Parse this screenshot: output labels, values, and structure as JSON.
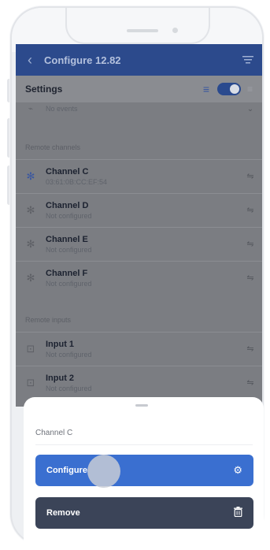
{
  "appbar": {
    "title": "Configure 12.82",
    "back_icon": "chevron-left-icon",
    "menu_icon": "filter-menu-icon",
    "color": "#2c4a8c"
  },
  "settings": {
    "label": "Settings",
    "events_text": "No events"
  },
  "remote_channels": {
    "heading": "Remote channels",
    "items": [
      {
        "name": "Channel C",
        "sub": "03:61:0B:CC:EF:54"
      },
      {
        "name": "Channel D",
        "sub": "Not configured"
      },
      {
        "name": "Channel E",
        "sub": "Not configured"
      },
      {
        "name": "Channel F",
        "sub": "Not configured"
      }
    ]
  },
  "remote_inputs": {
    "heading": "Remote inputs",
    "items": [
      {
        "name": "Input 1",
        "sub": "Not configured"
      },
      {
        "name": "Input 2",
        "sub": "Not configured"
      }
    ]
  },
  "sheet": {
    "title": "Channel C",
    "configure_label": "Configure",
    "remove_label": "Remove",
    "configure_color": "#3a6fd0",
    "remove_color": "#3b4458"
  }
}
